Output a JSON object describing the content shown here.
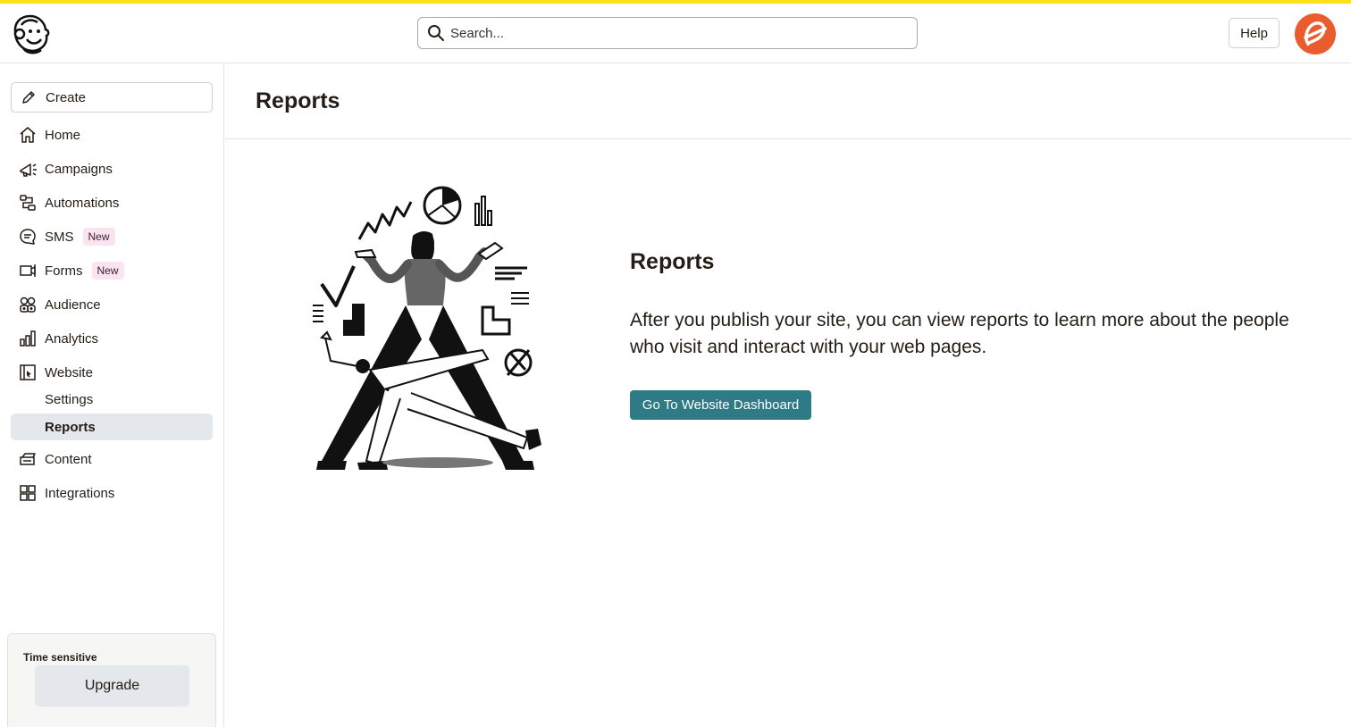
{
  "colors": {
    "top_stripe": "#ffe01b",
    "accent_button": "#2e7a85",
    "active_nav_bg": "#e4e8ec",
    "badge_bg": "#fbe3ef",
    "avatar": "#e85c2e"
  },
  "topbar": {
    "logo_icon": "mailchimp-freddie-logo",
    "search": {
      "placeholder": "Search...",
      "icon": "search-icon"
    },
    "help_label": "Help",
    "avatar_icon": "user-avatar"
  },
  "sidebar": {
    "create_label": "Create",
    "items": [
      {
        "label": "Home",
        "icon": "home-icon"
      },
      {
        "label": "Campaigns",
        "icon": "megaphone-icon"
      },
      {
        "label": "Automations",
        "icon": "automation-icon"
      },
      {
        "label": "SMS",
        "icon": "chat-icon",
        "badge": "New"
      },
      {
        "label": "Forms",
        "icon": "form-icon",
        "badge": "New"
      },
      {
        "label": "Audience",
        "icon": "audience-icon"
      },
      {
        "label": "Analytics",
        "icon": "bar-chart-icon"
      },
      {
        "label": "Website",
        "icon": "website-icon"
      },
      {
        "label": "Content",
        "icon": "content-icon"
      },
      {
        "label": "Integrations",
        "icon": "grid-icon"
      }
    ],
    "website_sub": [
      {
        "label": "Settings",
        "active": false
      },
      {
        "label": "Reports",
        "active": true
      }
    ],
    "promo": {
      "label": "Time sensitive",
      "button": "Upgrade"
    }
  },
  "main": {
    "page_title": "Reports",
    "section_title": "Reports",
    "description": "After you publish your site, you can view reports to learn more about the people who visit and interact with your web pages.",
    "cta_label": "Go To Website Dashboard",
    "illustration_icon": "juggling-analytics-illustration"
  }
}
